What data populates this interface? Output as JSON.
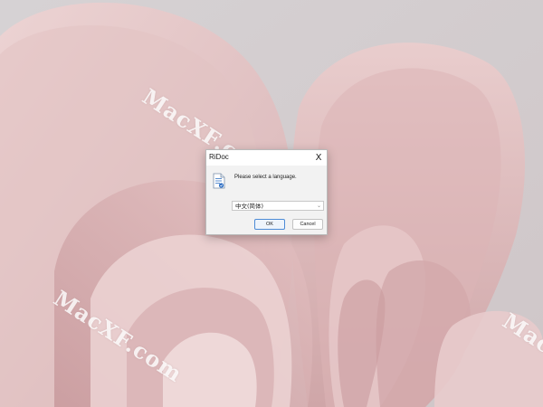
{
  "desktop": {
    "wallpaper": "pink-flower-bloom",
    "watermark_text": "MacXF.com"
  },
  "dialog": {
    "title": "RiDoc",
    "close_label": "X",
    "icon": "document-icon",
    "prompt": "Please select a language.",
    "language_select": {
      "value": "中文(简体)"
    },
    "ok_label": "OK",
    "cancel_label": "Cancel"
  },
  "colors": {
    "ok_border": "#4d8bd6",
    "dialog_bg": "#f2f2f2",
    "titlebar_bg": "#ffffff"
  }
}
